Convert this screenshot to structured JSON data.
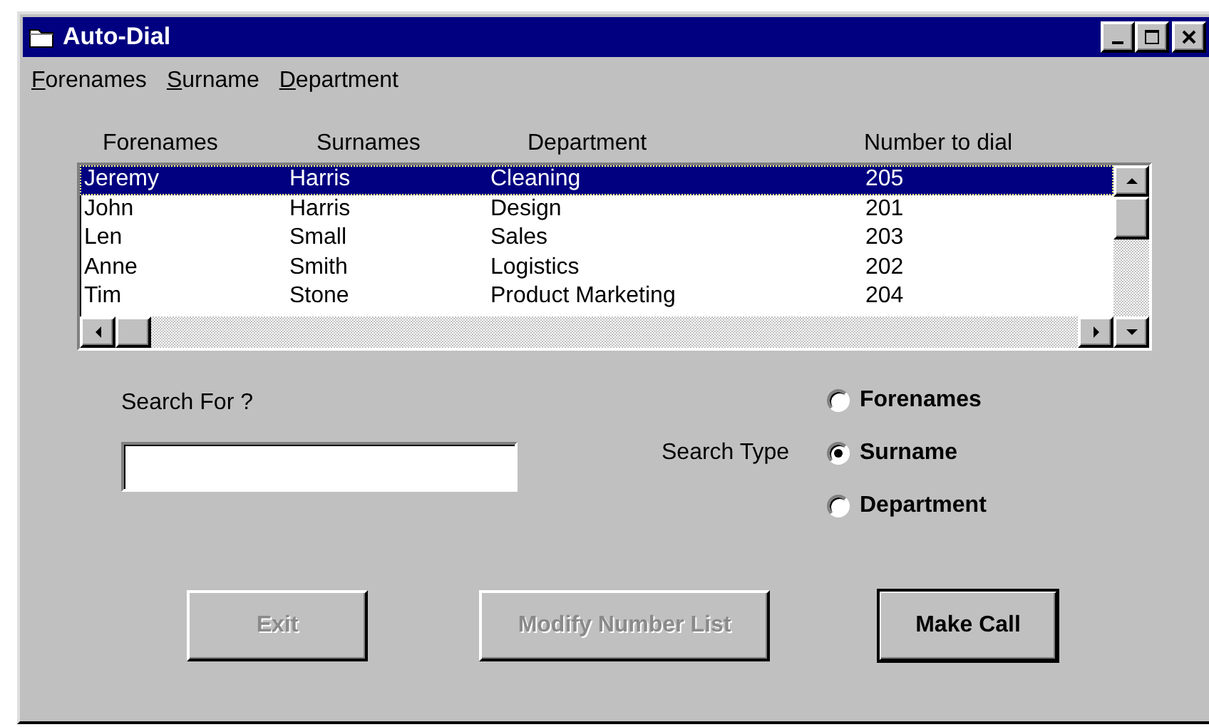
{
  "window": {
    "title": "Auto-Dial"
  },
  "menu": [
    {
      "label": "Forenames"
    },
    {
      "label": "Surname"
    },
    {
      "label": "Department"
    }
  ],
  "table": {
    "columns": [
      "Forenames",
      "Surnames",
      "Department",
      "Number to dial"
    ],
    "rows": [
      {
        "cells": [
          "Jeremy",
          "Harris",
          "Cleaning",
          "205"
        ],
        "selected": true
      },
      {
        "cells": [
          "John",
          "Harris",
          "Design",
          "201"
        ],
        "selected": false
      },
      {
        "cells": [
          "Len",
          "Small",
          "Sales",
          "203"
        ],
        "selected": false
      },
      {
        "cells": [
          "Anne",
          "Smith",
          "Logistics",
          "202"
        ],
        "selected": false
      },
      {
        "cells": [
          "Tim",
          "Stone",
          "Product Marketing",
          "204"
        ],
        "selected": false
      }
    ]
  },
  "search": {
    "label": "Search For ?"
  },
  "search_type": {
    "label": "Search Type",
    "options": [
      {
        "label": "Forenames",
        "selected": false
      },
      {
        "label": "Surname",
        "selected": true
      },
      {
        "label": "Department",
        "selected": false
      }
    ]
  },
  "buttons": [
    {
      "label": "Exit",
      "disabled": true,
      "default": false
    },
    {
      "label": "Modify Number List",
      "disabled": true,
      "default": false
    },
    {
      "label": "Make Call",
      "disabled": false,
      "default": true
    }
  ]
}
